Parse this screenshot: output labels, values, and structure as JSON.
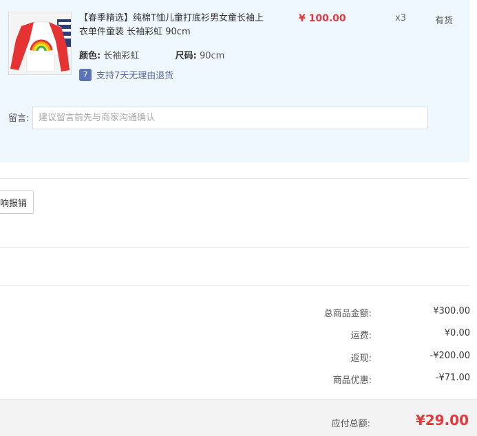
{
  "item": {
    "title": "【春季精选】纯棉T恤儿童打底衫男女童长袖上衣单件童装 长袖彩虹 90cm",
    "price": "¥ 100.00",
    "quantity": "x3",
    "stock_status": "有货",
    "attributes": [
      {
        "label": "颜色:",
        "value": "长袖彩虹"
      },
      {
        "label": "尺码:",
        "value": "90cm"
      }
    ],
    "return_policy": {
      "badge": "7",
      "text": "支持7天无理由退货"
    }
  },
  "message": {
    "label": "留言:",
    "placeholder": "建议留言前先与商家沟通确认"
  },
  "invoice": {
    "button_label": "响报销"
  },
  "summary": {
    "rows": [
      {
        "label": "总商品金额:",
        "value": "¥300.00"
      },
      {
        "label": "运费:",
        "value": "¥0.00"
      },
      {
        "label": "返现:",
        "value": "-¥200.00"
      },
      {
        "label": "商品优惠:",
        "value": "-¥71.00"
      }
    ],
    "total_label": "应付总额:",
    "total_value": "¥29.00"
  },
  "colors": {
    "accent_red": "#e4393c",
    "panel_bg": "#f0f8ff",
    "badge_blue": "#5b73b8"
  }
}
